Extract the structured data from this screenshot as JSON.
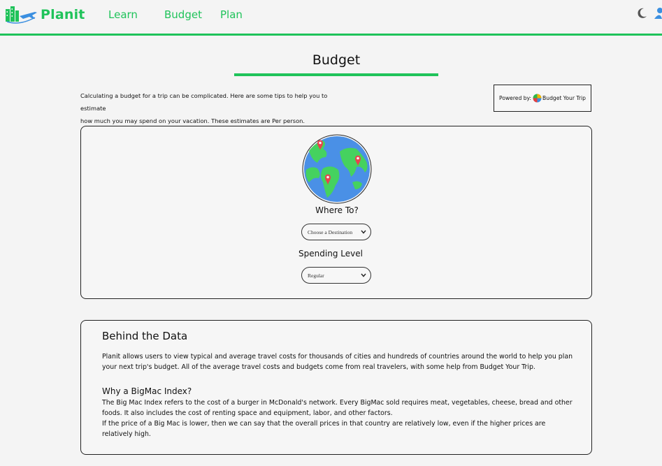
{
  "nav": {
    "brand": "Planit",
    "links": [
      "Learn",
      "Budget",
      "Plan"
    ],
    "accent_color": "#1fc35a",
    "icons": [
      "moon-icon",
      "user-icon"
    ]
  },
  "page": {
    "title": "Budget",
    "intro_line1": "Calculating a budget for a trip can be complicated. Here are some tips to help you to estimate",
    "intro_line2": "how much you may spend on your vacation. These estimates are Per person.",
    "powered_by_label": "Powered by:",
    "powered_by_name": "Budget Your Trip"
  },
  "budget_form": {
    "where_label": "Where To?",
    "destination_value": "Choose a Destination",
    "spending_label": "Spending Level",
    "spending_value": "Regular"
  },
  "about": {
    "title": "Behind the Data",
    "paragraph1": "Planit allows users to view typical and average travel costs for thousands of cities and hundreds of countries around the world to help you plan your next trip's budget. All of the average travel costs and budgets come from real travelers, with some help from Budget Your Trip.",
    "bigmac_title": "Why a BigMac Index?",
    "bigmac_p1": "The Big Mac Index refers to the cost of a burger in McDonald's network. Every BigMac sold requires meat, vegetables, cheese, bread and other foods. It also includes the cost of renting space and equipment, labor, and other factors.",
    "bigmac_p2": "If the price of a Big Mac is lower, then we can say that the overall prices in that country are relatively low, even if the higher prices are relatively high."
  }
}
